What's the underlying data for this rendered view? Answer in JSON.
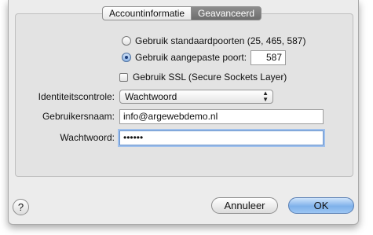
{
  "tabs": [
    {
      "label": "Accountinformatie",
      "active": false
    },
    {
      "label": "Geavanceerd",
      "active": true
    }
  ],
  "ports": {
    "standard_label": "Gebruik standaardpoorten (25, 465, 587)",
    "standard_selected": false,
    "custom_label": "Gebruik aangepaste poort:",
    "custom_selected": true,
    "custom_value": "587"
  },
  "ssl": {
    "label": "Gebruik SSL (Secure Sockets Layer)",
    "checked": false
  },
  "auth": {
    "label": "Identiteitscontrole:",
    "value": "Wachtwoord"
  },
  "username": {
    "label": "Gebruikersnaam:",
    "value": "info@argewebdemo.nl"
  },
  "password": {
    "label": "Wachtwoord:",
    "value": "••••••"
  },
  "footer": {
    "help": "?",
    "cancel": "Annuleer",
    "ok": "OK"
  },
  "colors": {
    "accent": "#7fb1ea",
    "focus_ring": "#9fc0ec",
    "tab_active": "#7a7a7a"
  }
}
